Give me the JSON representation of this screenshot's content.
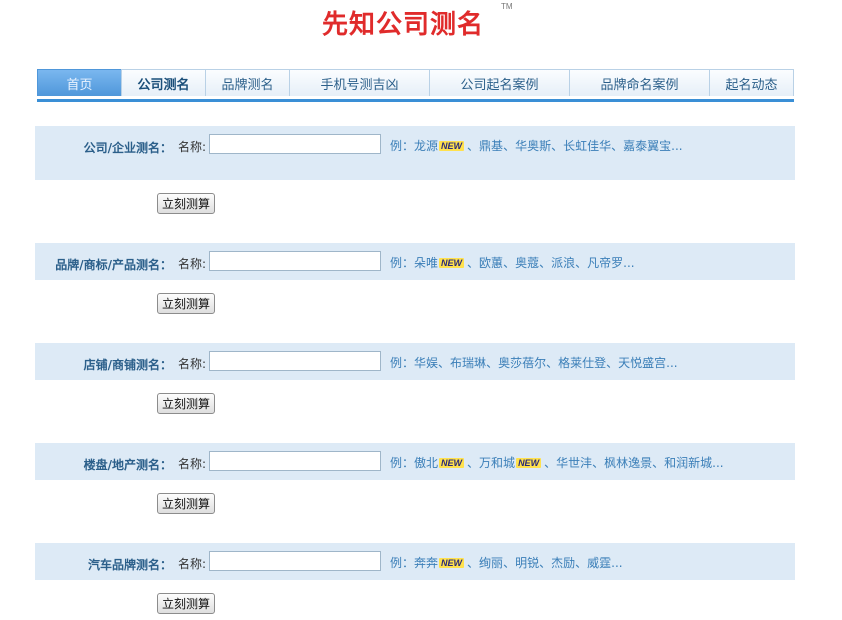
{
  "header": {
    "title": "先知公司测名",
    "tm": "TM"
  },
  "nav": {
    "tabs": [
      {
        "label": "首页",
        "width": 84
      },
      {
        "label": "公司测名",
        "width": 84
      },
      {
        "label": "品牌测名",
        "width": 84
      },
      {
        "label": "手机号测吉凶",
        "width": 140
      },
      {
        "label": "公司起名案例",
        "width": 140
      },
      {
        "label": "品牌命名案例",
        "width": 140
      },
      {
        "label": "起名动态",
        "width": 85
      }
    ]
  },
  "common": {
    "name_label": "名称:",
    "button_label": "立刻测算",
    "badge": "NEW"
  },
  "sections": [
    {
      "label": "公司/企业测名：",
      "example_prefix": "例：",
      "items": [
        {
          "text": "龙源",
          "new": true
        },
        {
          "text": "鼎基",
          "new": false
        },
        {
          "text": "华奥斯",
          "new": false
        },
        {
          "text": "长虹佳华",
          "new": false
        },
        {
          "text": "嘉泰翼宝...",
          "new": false
        }
      ]
    },
    {
      "label": "品牌/商标/产品测名：",
      "example_prefix": "例：",
      "items": [
        {
          "text": "朵唯",
          "new": true
        },
        {
          "text": "欧蕙",
          "new": false
        },
        {
          "text": "奥蔻",
          "new": false
        },
        {
          "text": "派浪",
          "new": false
        },
        {
          "text": "凡帝罗...",
          "new": false
        }
      ]
    },
    {
      "label": "店铺/商铺测名：",
      "example_prefix": "例：",
      "items": [
        {
          "text": "华娱",
          "new": false
        },
        {
          "text": "布瑞琳",
          "new": false
        },
        {
          "text": "奥莎蓓尔",
          "new": false
        },
        {
          "text": "格莱仕登",
          "new": false
        },
        {
          "text": "天悦盛宫...",
          "new": false
        }
      ]
    },
    {
      "label": "楼盘/地产测名：",
      "example_prefix": "例：",
      "items": [
        {
          "text": "傲北",
          "new": true
        },
        {
          "text": "万和城",
          "new": true
        },
        {
          "text": "华世沣",
          "new": false
        },
        {
          "text": "枫林逸景",
          "new": false
        },
        {
          "text": "和润新城...",
          "new": false
        }
      ]
    },
    {
      "label": "汽车品牌测名：",
      "example_prefix": "例：",
      "items": [
        {
          "text": "奔奔",
          "new": true
        },
        {
          "text": "绚丽",
          "new": false
        },
        {
          "text": "明锐",
          "new": false
        },
        {
          "text": "杰励",
          "new": false
        },
        {
          "text": "威霆...",
          "new": false
        }
      ]
    }
  ]
}
